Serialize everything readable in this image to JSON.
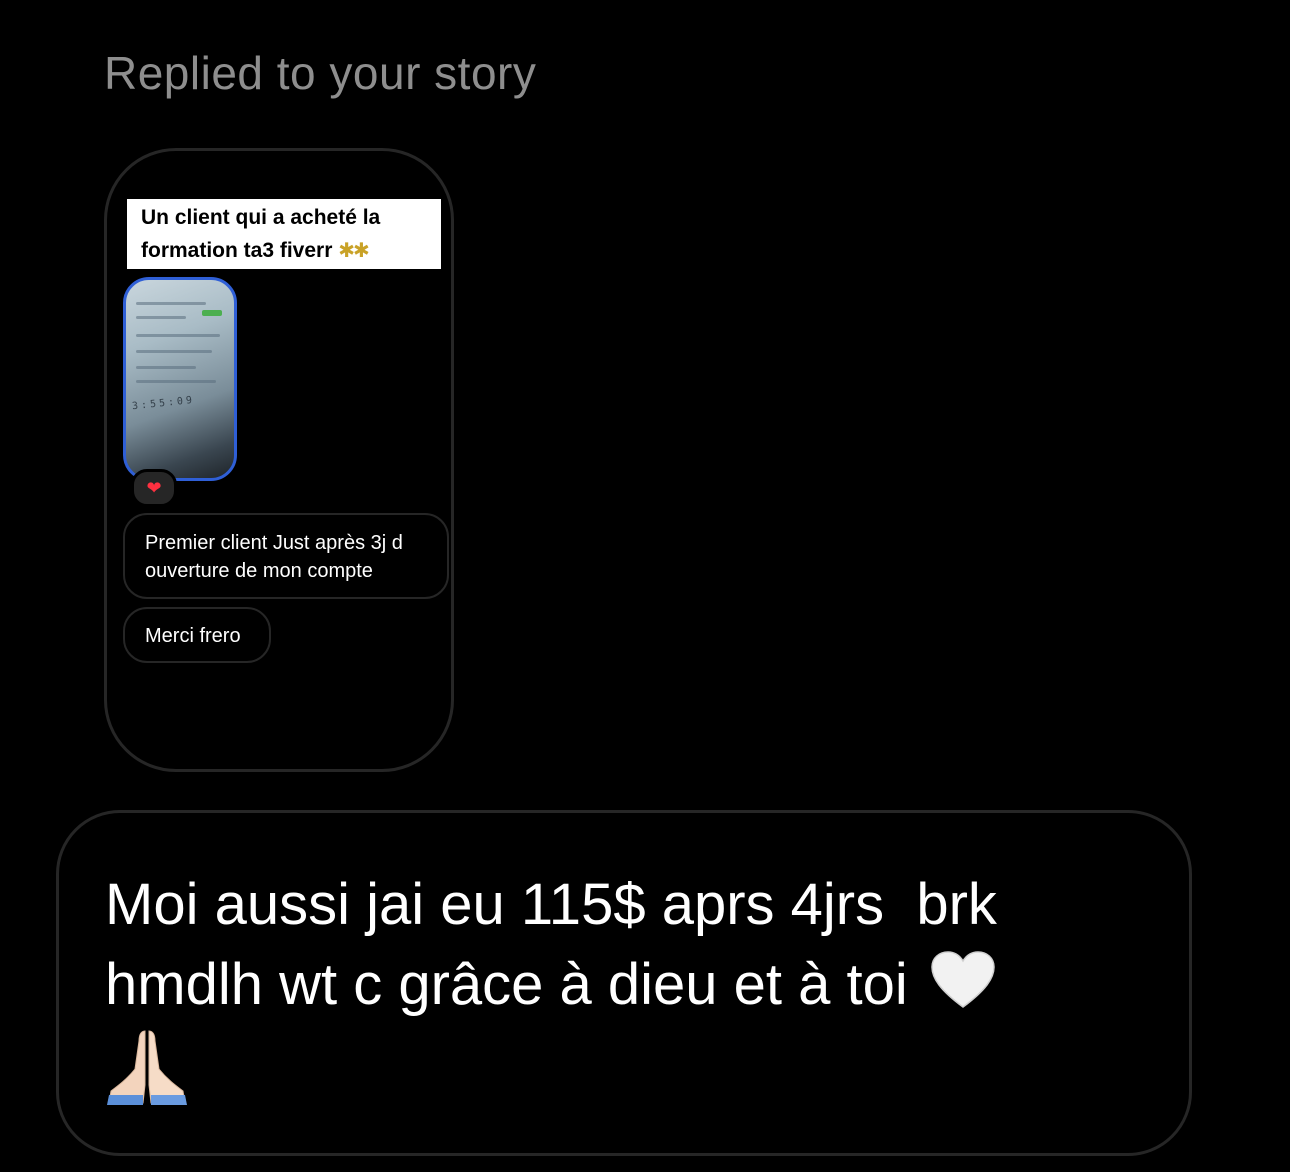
{
  "header": {
    "replied_label": "Replied to your story"
  },
  "story": {
    "caption_line_1": "Un client qui a acheté la",
    "caption_line_2": "formation ta3 fiverr",
    "caption_icon": "party-popper-icon",
    "thumbnail_digits": "3:55:09",
    "reaction_icon": "heart-icon",
    "replies": [
      "Premier client Just après 3j d ouverture de mon compte",
      "Merci frero"
    ]
  },
  "message": {
    "text": "Moi aussi jai eu 115$ aprs 4jrs  brk hmdlh wt c grâce à dieu et à toi",
    "trailing_icons": [
      "white-heart-icon",
      "folded-hands-icon"
    ]
  },
  "colors": {
    "background": "#000000",
    "muted_label": "#8e8e8e",
    "border": "#262626",
    "thumb_border": "#2f5fd6",
    "reaction_heart": "#ff3040"
  }
}
